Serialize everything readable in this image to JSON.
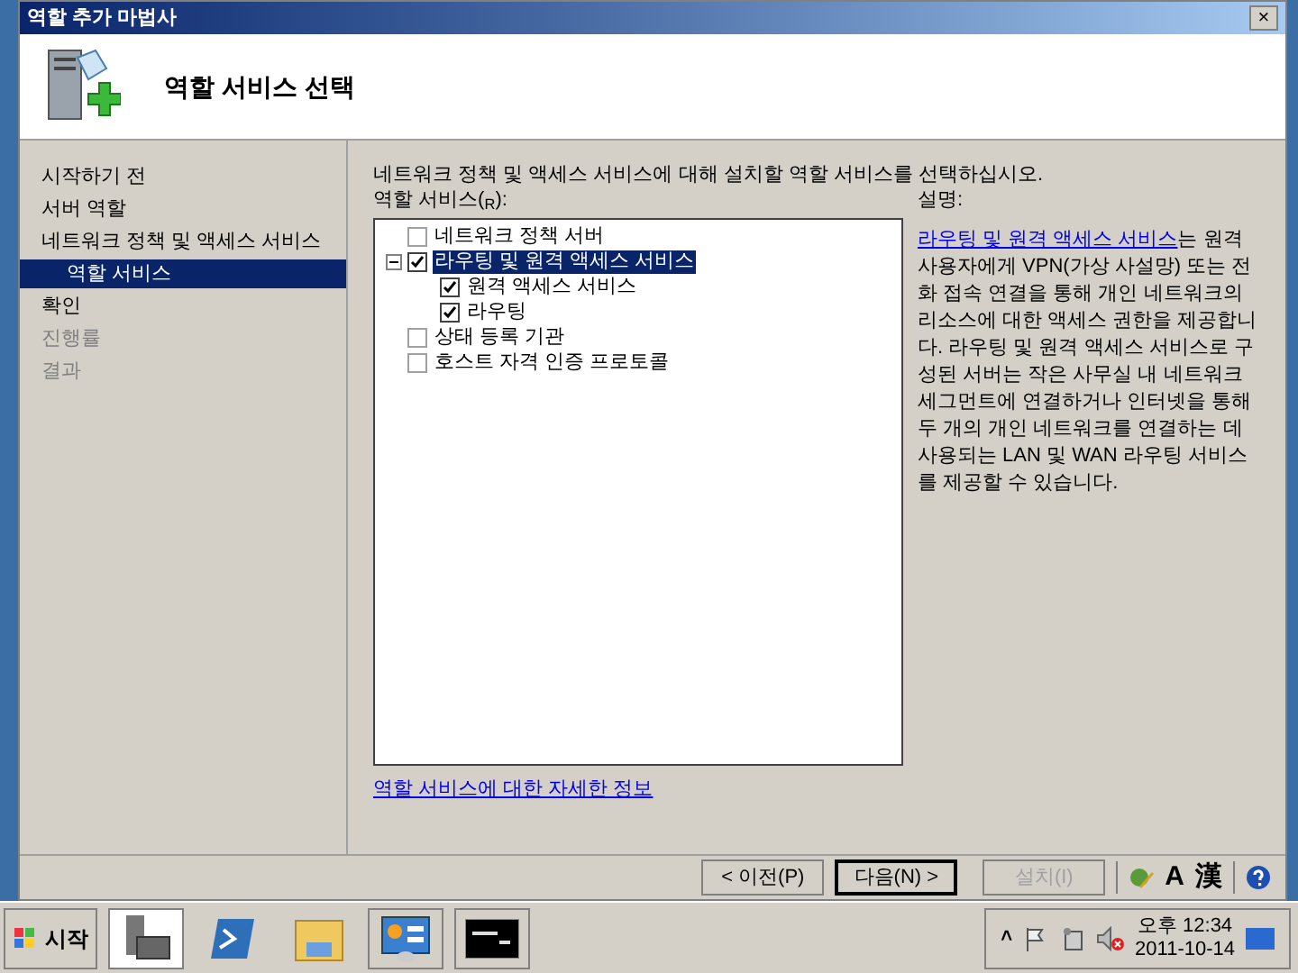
{
  "window": {
    "title": "역할 추가 마법사",
    "close": "×"
  },
  "header": {
    "title": "역할 서비스 선택"
  },
  "nav": [
    {
      "label": "시작하기 전",
      "selected": false,
      "disabled": false
    },
    {
      "label": "서버 역할",
      "selected": false,
      "disabled": false
    },
    {
      "label": "네트워크 정책 및 액세스 서비스",
      "selected": false,
      "disabled": false,
      "children": [
        {
          "label": "역할 서비스",
          "selected": true,
          "disabled": false
        }
      ]
    },
    {
      "label": "확인",
      "selected": false,
      "disabled": false
    },
    {
      "label": "진행률",
      "selected": false,
      "disabled": true
    },
    {
      "label": "결과",
      "selected": false,
      "disabled": true
    }
  ],
  "instruction": "네트워크 정책 및 액세스 서비스에 대해 설치할 역할 서비스를 선택하십시오.",
  "services_label": "역할 서비스($_{R}$):",
  "services": [
    {
      "label": "네트워크 정책 서버",
      "checked": false,
      "selected": false
    },
    {
      "label": "라우팅 및 원격 액세스 서비스",
      "checked": true,
      "selected": true,
      "expanded": true,
      "children": [
        {
          "label": "원격 액세스 서비스",
          "checked": true,
          "selected": false
        },
        {
          "label": "라우팅",
          "checked": true,
          "selected": false
        }
      ]
    },
    {
      "label": "상태 등록 기관",
      "checked": false,
      "selected": false
    },
    {
      "label": "호스트 자격 인증 프로토콜",
      "checked": false,
      "selected": false
    }
  ],
  "description_label": "설명:",
  "description_link": "라우팅 및 원격 액세스 서비스",
  "description": "는 원격  사용자에게 VPN(가상 사설망) 또는 전화 접속 연결을 통해 개인 네트워크의 리소스에 대한 액세스 권한을 제공합니다. 라우팅 및 원격 액세스 서비스로 구성된 서버는 작은 사무실 내 네트워크 세그먼트에 연결하거나 인터넷을 통해 두 개의 개인 네트워크를 연결하는 데 사용되는 LAN 및 WAN 라우팅 서비스를 제공할 수 있습니다.",
  "more_info_link": "역할 서비스에 대한 자세한 정보",
  "buttons": [
    {
      "label": "< 이전(P)",
      "disabled": false,
      "default": false
    },
    {
      "label": "다음(N) >",
      "disabled": false,
      "default": true
    },
    {
      "label": "설치(I)",
      "disabled": true,
      "default": false
    }
  ],
  "language_bar": {
    "mode": "A",
    "hanja": "漢"
  },
  "taskbar": {
    "start": "시작",
    "clock_time": "오후 12:34",
    "clock_date": "2011-10-14",
    "tray_expand": "˄"
  }
}
